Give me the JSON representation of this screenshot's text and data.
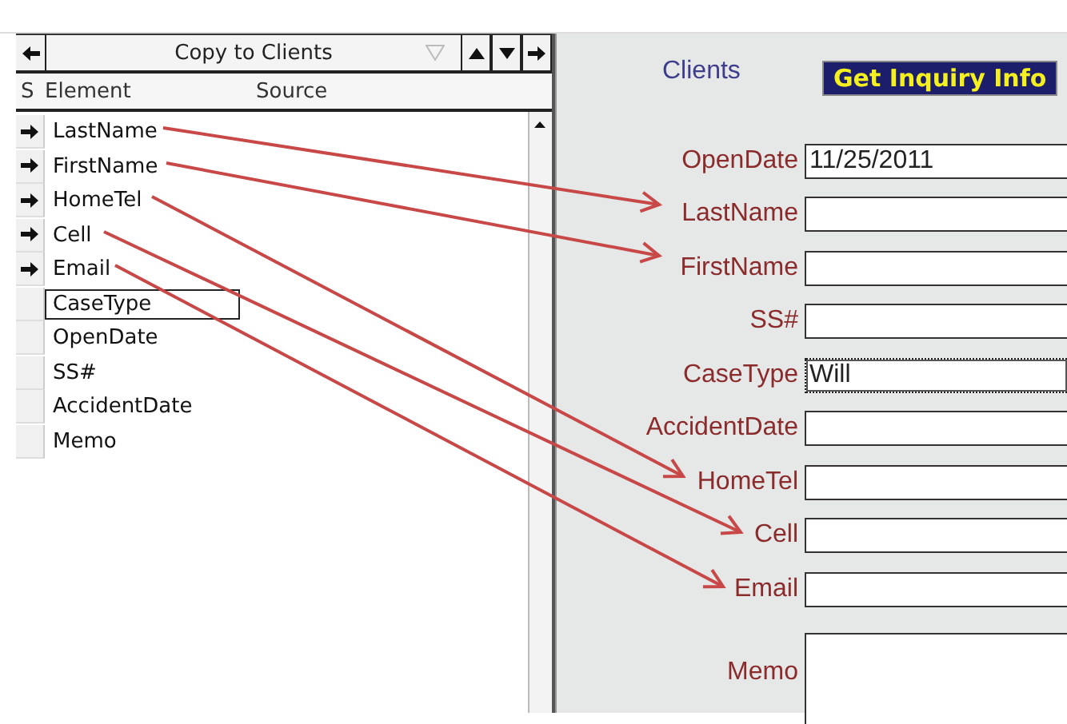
{
  "mapping_panel": {
    "title": "Copy to Clients",
    "columns": [
      "S",
      "Element",
      "Source"
    ],
    "elements": [
      {
        "name": "LastName",
        "mapped": true,
        "selected": false
      },
      {
        "name": "FirstName",
        "mapped": true,
        "selected": false
      },
      {
        "name": "HomeTel",
        "mapped": true,
        "selected": false
      },
      {
        "name": "Cell",
        "mapped": true,
        "selected": false
      },
      {
        "name": "Email",
        "mapped": true,
        "selected": false
      },
      {
        "name": "CaseType",
        "mapped": false,
        "selected": true
      },
      {
        "name": "OpenDate",
        "mapped": false,
        "selected": false
      },
      {
        "name": "SS#",
        "mapped": false,
        "selected": false
      },
      {
        "name": "AccidentDate",
        "mapped": false,
        "selected": false
      },
      {
        "name": "Memo",
        "mapped": false,
        "selected": false
      }
    ]
  },
  "form": {
    "title": "Clients",
    "button": "Get Inquiry Info",
    "fields": [
      {
        "label": "OpenDate",
        "value": "11/25/2011",
        "focused": false,
        "kind": "line"
      },
      {
        "label": "LastName",
        "focused": false,
        "kind": "line"
      },
      {
        "label": "FirstName",
        "focused": false,
        "kind": "line"
      },
      {
        "label": "SS#",
        "focused": false,
        "kind": "line"
      },
      {
        "label": "CaseType",
        "value": "Will",
        "focused": true,
        "kind": "line"
      },
      {
        "label": "AccidentDate",
        "focused": false,
        "kind": "line"
      },
      {
        "label": "HomeTel",
        "focused": false,
        "kind": "line"
      },
      {
        "label": "Cell",
        "focused": false,
        "kind": "line"
      },
      {
        "label": "Email",
        "focused": false,
        "kind": "line"
      },
      {
        "label": "Memo",
        "focused": false,
        "kind": "memo"
      }
    ]
  }
}
